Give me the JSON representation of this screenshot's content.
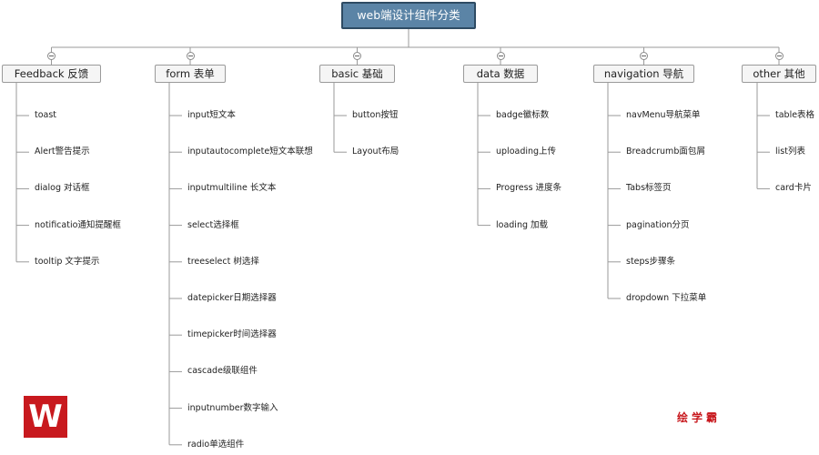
{
  "diagram": {
    "root": "web端设计组件分类",
    "categories": [
      {
        "label": "Feedback 反馈",
        "items": [
          "toast",
          "Alert警告提示",
          "dialog 对话框",
          "notificatio通知提醒框",
          "tooltip 文字提示"
        ]
      },
      {
        "label": "form 表单",
        "items": [
          "input短文本",
          "inputautocomplete短文本联想",
          "inputmultiline 长文本",
          "select选择框",
          "treeselect 树选择",
          "datepicker日期选择器",
          "timepicker时间选择器",
          "cascade级联组件",
          "inputnumber数字输入",
          "radio单选组件"
        ]
      },
      {
        "label": "basic 基础",
        "items": [
          "button按钮",
          "Layout布局"
        ]
      },
      {
        "label": "data 数据",
        "items": [
          "badge徽标数",
          "uploading上传",
          "Progress 进度条",
          "loading 加载"
        ]
      },
      {
        "label": "navigation 导航",
        "items": [
          "navMenu导航菜单",
          "Breadcrumb面包屑",
          "Tabs标签页",
          "pagination分页",
          "steps步骤条",
          "dropdown 下拉菜单"
        ]
      },
      {
        "label": "other 其他",
        "items": [
          "table表格",
          "list列表",
          "card卡片"
        ]
      }
    ]
  },
  "branding": {
    "logo_letter": "W",
    "brand_text": "绘学霸"
  },
  "colors": {
    "root_fill": "#5b84a6",
    "root_border": "#2e4b63",
    "node_fill": "#f5f5f5",
    "node_border": "#9a9a9a",
    "line": "#9a9a9a",
    "brand_red": "#c8191e"
  }
}
